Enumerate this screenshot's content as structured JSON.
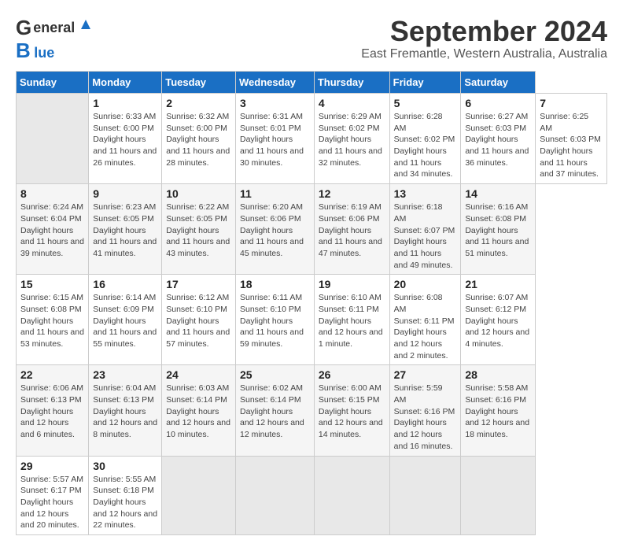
{
  "header": {
    "logo_line1": "General",
    "logo_line2": "Blue",
    "title": "September 2024",
    "subtitle": "East Fremantle, Western Australia, Australia"
  },
  "calendar": {
    "days_of_week": [
      "Sunday",
      "Monday",
      "Tuesday",
      "Wednesday",
      "Thursday",
      "Friday",
      "Saturday"
    ],
    "weeks": [
      [
        {
          "num": "",
          "empty": true
        },
        {
          "num": "1",
          "sunrise": "6:33 AM",
          "sunset": "6:00 PM",
          "daylight": "11 hours and 26 minutes."
        },
        {
          "num": "2",
          "sunrise": "6:32 AM",
          "sunset": "6:00 PM",
          "daylight": "11 hours and 28 minutes."
        },
        {
          "num": "3",
          "sunrise": "6:31 AM",
          "sunset": "6:01 PM",
          "daylight": "11 hours and 30 minutes."
        },
        {
          "num": "4",
          "sunrise": "6:29 AM",
          "sunset": "6:02 PM",
          "daylight": "11 hours and 32 minutes."
        },
        {
          "num": "5",
          "sunrise": "6:28 AM",
          "sunset": "6:02 PM",
          "daylight": "11 hours and 34 minutes."
        },
        {
          "num": "6",
          "sunrise": "6:27 AM",
          "sunset": "6:03 PM",
          "daylight": "11 hours and 36 minutes."
        },
        {
          "num": "7",
          "sunrise": "6:25 AM",
          "sunset": "6:03 PM",
          "daylight": "11 hours and 37 minutes."
        }
      ],
      [
        {
          "num": "8",
          "sunrise": "6:24 AM",
          "sunset": "6:04 PM",
          "daylight": "11 hours and 39 minutes."
        },
        {
          "num": "9",
          "sunrise": "6:23 AM",
          "sunset": "6:05 PM",
          "daylight": "11 hours and 41 minutes."
        },
        {
          "num": "10",
          "sunrise": "6:22 AM",
          "sunset": "6:05 PM",
          "daylight": "11 hours and 43 minutes."
        },
        {
          "num": "11",
          "sunrise": "6:20 AM",
          "sunset": "6:06 PM",
          "daylight": "11 hours and 45 minutes."
        },
        {
          "num": "12",
          "sunrise": "6:19 AM",
          "sunset": "6:06 PM",
          "daylight": "11 hours and 47 minutes."
        },
        {
          "num": "13",
          "sunrise": "6:18 AM",
          "sunset": "6:07 PM",
          "daylight": "11 hours and 49 minutes."
        },
        {
          "num": "14",
          "sunrise": "6:16 AM",
          "sunset": "6:08 PM",
          "daylight": "11 hours and 51 minutes."
        }
      ],
      [
        {
          "num": "15",
          "sunrise": "6:15 AM",
          "sunset": "6:08 PM",
          "daylight": "11 hours and 53 minutes."
        },
        {
          "num": "16",
          "sunrise": "6:14 AM",
          "sunset": "6:09 PM",
          "daylight": "11 hours and 55 minutes."
        },
        {
          "num": "17",
          "sunrise": "6:12 AM",
          "sunset": "6:10 PM",
          "daylight": "11 hours and 57 minutes."
        },
        {
          "num": "18",
          "sunrise": "6:11 AM",
          "sunset": "6:10 PM",
          "daylight": "11 hours and 59 minutes."
        },
        {
          "num": "19",
          "sunrise": "6:10 AM",
          "sunset": "6:11 PM",
          "daylight": "12 hours and 1 minute."
        },
        {
          "num": "20",
          "sunrise": "6:08 AM",
          "sunset": "6:11 PM",
          "daylight": "12 hours and 2 minutes."
        },
        {
          "num": "21",
          "sunrise": "6:07 AM",
          "sunset": "6:12 PM",
          "daylight": "12 hours and 4 minutes."
        }
      ],
      [
        {
          "num": "22",
          "sunrise": "6:06 AM",
          "sunset": "6:13 PM",
          "daylight": "12 hours and 6 minutes."
        },
        {
          "num": "23",
          "sunrise": "6:04 AM",
          "sunset": "6:13 PM",
          "daylight": "12 hours and 8 minutes."
        },
        {
          "num": "24",
          "sunrise": "6:03 AM",
          "sunset": "6:14 PM",
          "daylight": "12 hours and 10 minutes."
        },
        {
          "num": "25",
          "sunrise": "6:02 AM",
          "sunset": "6:14 PM",
          "daylight": "12 hours and 12 minutes."
        },
        {
          "num": "26",
          "sunrise": "6:00 AM",
          "sunset": "6:15 PM",
          "daylight": "12 hours and 14 minutes."
        },
        {
          "num": "27",
          "sunrise": "5:59 AM",
          "sunset": "6:16 PM",
          "daylight": "12 hours and 16 minutes."
        },
        {
          "num": "28",
          "sunrise": "5:58 AM",
          "sunset": "6:16 PM",
          "daylight": "12 hours and 18 minutes."
        }
      ],
      [
        {
          "num": "29",
          "sunrise": "5:57 AM",
          "sunset": "6:17 PM",
          "daylight": "12 hours and 20 minutes."
        },
        {
          "num": "30",
          "sunrise": "5:55 AM",
          "sunset": "6:18 PM",
          "daylight": "12 hours and 22 minutes."
        },
        {
          "num": "",
          "empty": true
        },
        {
          "num": "",
          "empty": true
        },
        {
          "num": "",
          "empty": true
        },
        {
          "num": "",
          "empty": true
        },
        {
          "num": "",
          "empty": true
        }
      ]
    ]
  }
}
